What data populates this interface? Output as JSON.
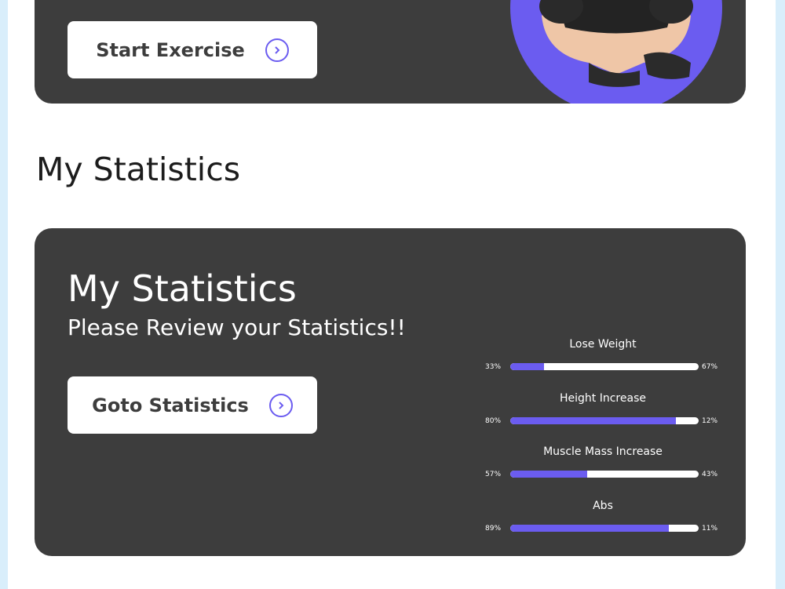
{
  "exercise_card": {
    "start_button_label": "Start Exercise"
  },
  "section": {
    "title": "My Statistics"
  },
  "stats_card": {
    "title": "My Statistics",
    "subtitle": "Please Review your Statistics!!",
    "goto_button_label": "Goto Statistics",
    "bars": [
      {
        "label": "Lose Weight",
        "left": "33%",
        "right": "67%",
        "fill": 0.18
      },
      {
        "label": "Height Increase",
        "left": "80%",
        "right": "12%",
        "fill": 0.88
      },
      {
        "label": "Muscle Mass Increase",
        "left": "57%",
        "right": "43%",
        "fill": 0.41
      },
      {
        "label": "Abs",
        "left": "89%",
        "right": "11%",
        "fill": 0.84
      }
    ]
  },
  "colors": {
    "accent": "#6b5cf0",
    "card": "#3d3d3d"
  },
  "icons": {
    "button_icon": "chevron-right-circle-icon"
  }
}
